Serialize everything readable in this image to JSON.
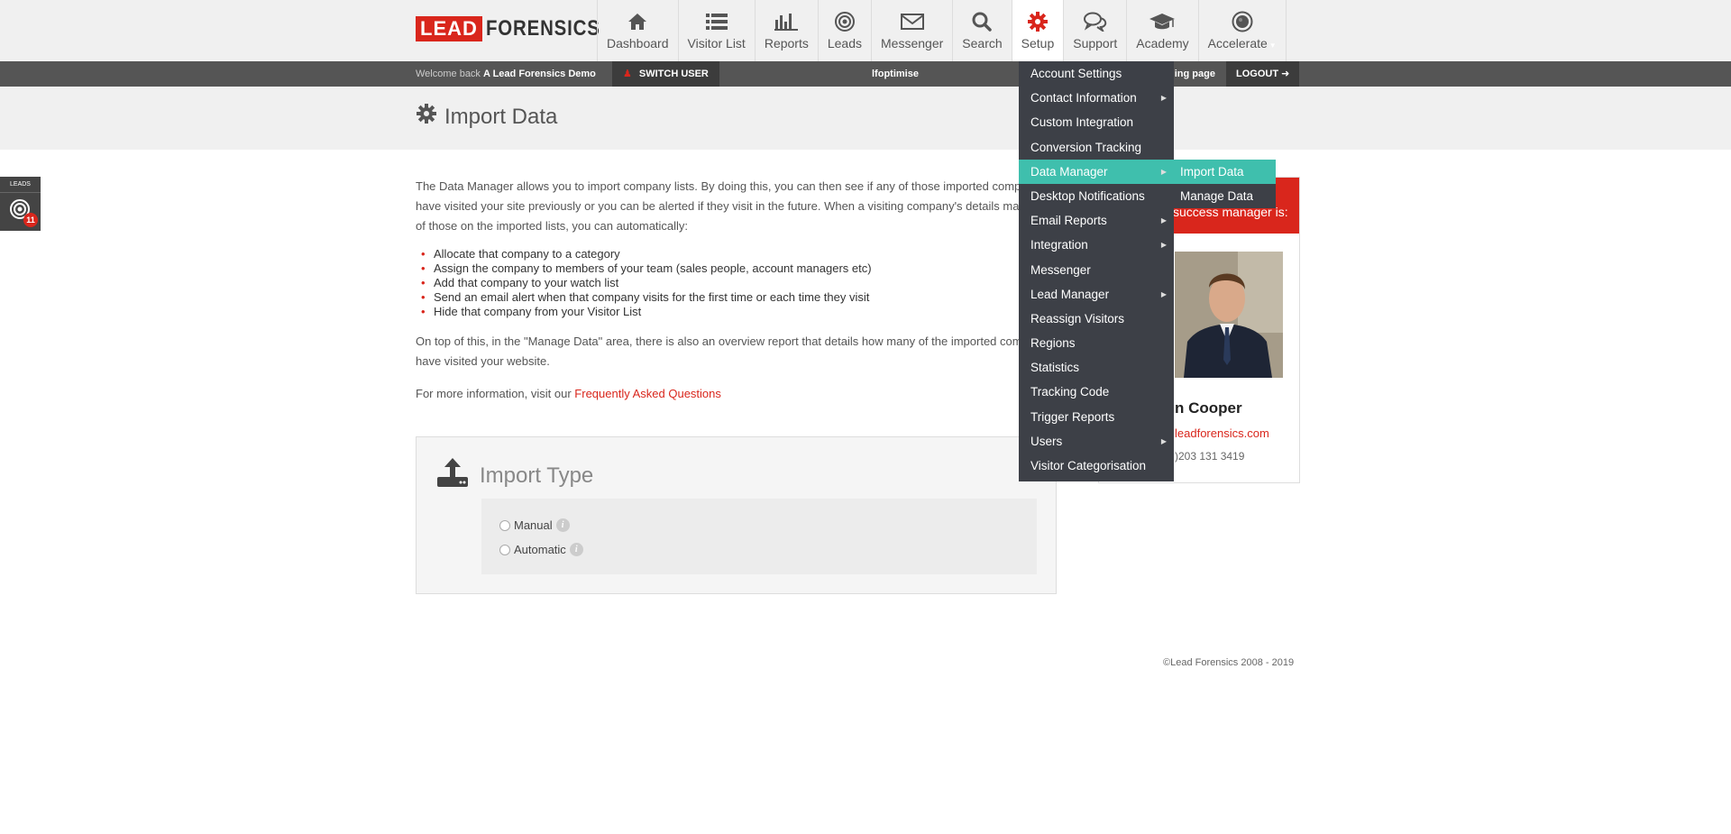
{
  "logo": {
    "lead": "LEAD",
    "forensics": "FORENSICS"
  },
  "nav": [
    {
      "label": "Dashboard",
      "icon": "home-icon"
    },
    {
      "label": "Visitor List",
      "icon": "list-icon"
    },
    {
      "label": "Reports",
      "icon": "bar-chart-icon"
    },
    {
      "label": "Leads",
      "icon": "target-icon"
    },
    {
      "label": "Messenger",
      "icon": "envelope-icon"
    },
    {
      "label": "Search",
      "icon": "search-icon"
    },
    {
      "label": "Setup",
      "icon": "gear-icon"
    },
    {
      "label": "Support",
      "icon": "chat-icon"
    },
    {
      "label": "Academy",
      "icon": "graduation-cap-icon"
    },
    {
      "label": "Accelerate",
      "icon": "accelerate-icon"
    }
  ],
  "userbar": {
    "welcome_prefix": "Welcome back",
    "account_name": "A Lead Forensics Demo",
    "switch_user": "SWITCH USER",
    "optimise": "lfoptimise",
    "landing_page": "ding page",
    "logout": "LOGOUT"
  },
  "page": {
    "title": "Import Data"
  },
  "leads_widget": {
    "label": "LEADS",
    "count": "11"
  },
  "content": {
    "intro": "The Data Manager allows you to import company lists. By doing this, you can then see if any of those imported companies have visited your site previously or you can be alerted if they visit in the future. When a visiting company's details match one of those on the imported lists, you can automatically:",
    "bullets": [
      "Allocate that company to a category",
      "Assign the company to members of your team (sales people, account managers etc)",
      "Add that company to your watch list",
      "Send an email alert when that company visits for the first time or each time they visit",
      "Hide that company from your Visitor List"
    ],
    "overview": "On top of this, in the \"Manage Data\" area, there is also an overview report that details how many of the imported companies have visited your website.",
    "more_info_prefix": "For more information, visit our",
    "faq_link": "Frequently Asked Questions"
  },
  "import_type": {
    "heading": "Import Type",
    "options": [
      "Manual",
      "Automatic"
    ],
    "info_glyph": "i"
  },
  "account_manager": {
    "banner": "success manager is:",
    "name": "n Cooper",
    "email": "leadforensics.com",
    "phone": ")203 131 3419"
  },
  "footer": "©Lead Forensics 2008 - 2019",
  "setup_menu": [
    {
      "label": "Account Settings",
      "has_sub": false
    },
    {
      "label": "Contact Information",
      "has_sub": true
    },
    {
      "label": "Custom Integration",
      "has_sub": false
    },
    {
      "label": "Conversion Tracking",
      "has_sub": false
    },
    {
      "label": "Data Manager",
      "has_sub": true,
      "active": true
    },
    {
      "label": "Desktop Notifications",
      "has_sub": false
    },
    {
      "label": "Email Reports",
      "has_sub": true
    },
    {
      "label": "Integration",
      "has_sub": true
    },
    {
      "label": "Messenger",
      "has_sub": false
    },
    {
      "label": "Lead Manager",
      "has_sub": true
    },
    {
      "label": "Reassign Visitors",
      "has_sub": false
    },
    {
      "label": "Regions",
      "has_sub": false
    },
    {
      "label": "Statistics",
      "has_sub": false
    },
    {
      "label": "Tracking Code",
      "has_sub": false
    },
    {
      "label": "Trigger Reports",
      "has_sub": false
    },
    {
      "label": "Users",
      "has_sub": true
    },
    {
      "label": "Visitor Categorisation",
      "has_sub": false
    }
  ],
  "data_manager_submenu": [
    {
      "label": "Import Data",
      "active": true
    },
    {
      "label": "Manage Data",
      "active": false
    }
  ],
  "colors": {
    "brand_red": "#d9261c",
    "menu_bg": "#3d4047",
    "menu_active": "#3fbfad",
    "userbar_bg": "#555555"
  }
}
